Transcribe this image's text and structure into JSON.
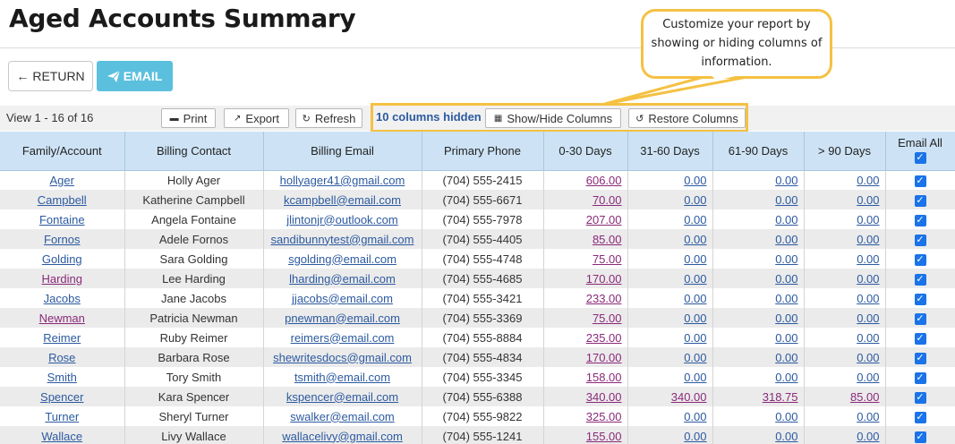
{
  "page_title": "Aged Accounts Summary",
  "buttons": {
    "return_label": "RETURN",
    "email_label": "EMAIL"
  },
  "callout_text": "Customize your report by showing or hiding columns of information.",
  "toolbar": {
    "view_count": "View 1 - 16 of 16",
    "print_label": "Print",
    "export_label": "Export",
    "refresh_label": "Refresh",
    "hidden_columns": "10 columns hidden",
    "show_hide_label": "Show/Hide Columns",
    "restore_label": "Restore Columns"
  },
  "columns": [
    "Family/Account",
    "Billing Contact",
    "Billing Email",
    "Primary Phone",
    "0-30 Days",
    "31-60 Days",
    "61-90 Days",
    "> 90 Days",
    "Email All"
  ],
  "rows": [
    {
      "account": "Ager",
      "contact": "Holly Ager",
      "email": "hollyager41@gmail.com",
      "phone": "(704) 555-2415",
      "d0_30": "606.00",
      "d31_60": "0.00",
      "d61_90": "0.00",
      "d90": "0.00",
      "visited": false
    },
    {
      "account": "Campbell",
      "contact": "Katherine Campbell",
      "email": "kcampbell@email.com",
      "phone": "(704) 555-6671",
      "d0_30": "70.00",
      "d31_60": "0.00",
      "d61_90": "0.00",
      "d90": "0.00",
      "visited": false
    },
    {
      "account": "Fontaine",
      "contact": "Angela Fontaine",
      "email": "jlintonjr@outlook.com",
      "phone": "(704) 555-7978",
      "d0_30": "207.00",
      "d31_60": "0.00",
      "d61_90": "0.00",
      "d90": "0.00",
      "visited": false
    },
    {
      "account": "Fornos",
      "contact": "Adele Fornos",
      "email": "sandibunnytest@gmail.com",
      "phone": "(704) 555-4405",
      "d0_30": "85.00",
      "d31_60": "0.00",
      "d61_90": "0.00",
      "d90": "0.00",
      "visited": false
    },
    {
      "account": "Golding",
      "contact": "Sara Golding",
      "email": "sgolding@email.com",
      "phone": "(704) 555-4748",
      "d0_30": "75.00",
      "d31_60": "0.00",
      "d61_90": "0.00",
      "d90": "0.00",
      "visited": false
    },
    {
      "account": "Harding",
      "contact": "Lee Harding",
      "email": "lharding@email.com",
      "phone": "(704) 555-4685",
      "d0_30": "170.00",
      "d31_60": "0.00",
      "d61_90": "0.00",
      "d90": "0.00",
      "visited": true
    },
    {
      "account": "Jacobs",
      "contact": "Jane Jacobs",
      "email": "jjacobs@email.com",
      "phone": "(704) 555-3421",
      "d0_30": "233.00",
      "d31_60": "0.00",
      "d61_90": "0.00",
      "d90": "0.00",
      "visited": false
    },
    {
      "account": "Newman",
      "contact": "Patricia Newman",
      "email": "pnewman@email.com",
      "phone": "(704) 555-3369",
      "d0_30": "75.00",
      "d31_60": "0.00",
      "d61_90": "0.00",
      "d90": "0.00",
      "visited": true
    },
    {
      "account": "Reimer",
      "contact": "Ruby Reimer",
      "email": "reimers@email.com",
      "phone": "(704) 555-8884",
      "d0_30": "235.00",
      "d31_60": "0.00",
      "d61_90": "0.00",
      "d90": "0.00",
      "visited": false
    },
    {
      "account": "Rose",
      "contact": "Barbara Rose",
      "email": "shewritesdocs@gmail.com",
      "phone": "(704) 555-4834",
      "d0_30": "170.00",
      "d31_60": "0.00",
      "d61_90": "0.00",
      "d90": "0.00",
      "visited": false
    },
    {
      "account": "Smith",
      "contact": "Tory Smith",
      "email": "tsmith@email.com",
      "phone": "(704) 555-3345",
      "d0_30": "158.00",
      "d31_60": "0.00",
      "d61_90": "0.00",
      "d90": "0.00",
      "visited": false
    },
    {
      "account": "Spencer",
      "contact": "Kara Spencer",
      "email": "kspencer@email.com",
      "phone": "(704) 555-6388",
      "d0_30": "340.00",
      "d31_60": "340.00",
      "d61_90": "318.75",
      "d90": "85.00",
      "visited": false
    },
    {
      "account": "Turner",
      "contact": "Sheryl Turner",
      "email": "swalker@email.com",
      "phone": "(704) 555-9822",
      "d0_30": "325.00",
      "d31_60": "0.00",
      "d61_90": "0.00",
      "d90": "0.00",
      "visited": false
    },
    {
      "account": "Wallace",
      "contact": "Livy Wallace",
      "email": "wallacelivy@gmail.com",
      "phone": "(704) 555-1241",
      "d0_30": "155.00",
      "d31_60": "0.00",
      "d61_90": "0.00",
      "d90": "0.00",
      "visited": false
    }
  ],
  "colors": {
    "header_bg": "#cde3f5",
    "email_btn": "#5bc0de",
    "highlight": "#f5c143",
    "link": "#2c5aa0",
    "amount_link": "#8b2a7a"
  }
}
